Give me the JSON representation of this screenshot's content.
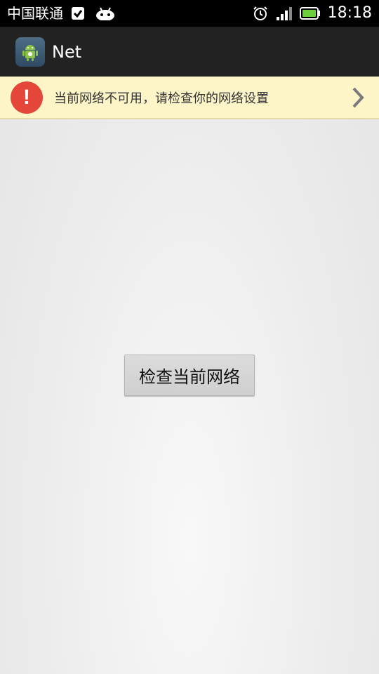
{
  "status_bar": {
    "carrier": "中国联通",
    "time": "18:18",
    "icons": [
      "check-notification-icon",
      "android-notification-icon",
      "alarm-icon",
      "signal-icon",
      "battery-icon"
    ]
  },
  "action_bar": {
    "title": "Net",
    "icon": "android-app-icon"
  },
  "banner": {
    "message": "当前网络不可用，请检查你的网络设置",
    "icon": "alert-icon",
    "accent_color": "#e4463a",
    "background_color": "#fdf5c8"
  },
  "main": {
    "check_button_label": "检查当前网络"
  }
}
